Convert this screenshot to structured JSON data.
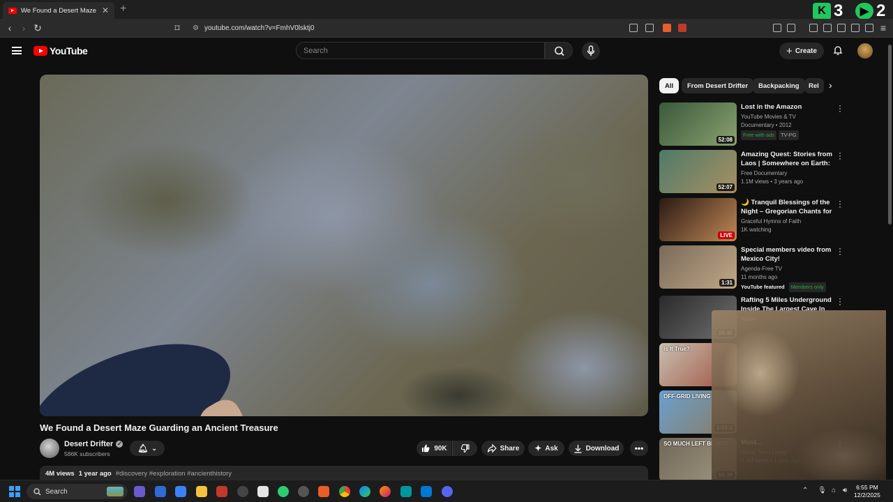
{
  "browser": {
    "tab_title": "We Found a Desert Maze Gu",
    "tab_close": "✕",
    "new_tab": "+",
    "url": "youtube.com/watch?v=FmhV0lsktj0",
    "ext_counts": [
      "3",
      "2"
    ]
  },
  "header": {
    "logo_text": "YouTube",
    "search_placeholder": "Search",
    "create_label": "Create"
  },
  "video": {
    "title": "We Found a Desert Maze Guarding an Ancient Treasure",
    "channel": "Desert Drifter",
    "subscribers": "586K subscribers",
    "likes": "90K",
    "share_label": "Share",
    "ask_label": "Ask",
    "download_label": "Download",
    "views": "4M views",
    "age": "1 year ago",
    "tags": "#discovery #exploration #ancienthistory"
  },
  "chips": [
    "All",
    "From Desert Drifter",
    "Backpacking",
    "Rel"
  ],
  "recommendations": [
    {
      "title": "Lost in the Amazon",
      "channel": "YouTube Movies & TV",
      "meta": "Documentary • 2012",
      "badges": [
        "Free with ads",
        "TV-PG"
      ],
      "duration": "52:08",
      "thumb_colors": [
        "#3a5a3a",
        "#8aa070"
      ]
    },
    {
      "title": "Amazing Quest: Stories from Laos | Somewhere on Earth: ...",
      "channel": "Free Documentary",
      "meta": "1.1M views • 3 years ago",
      "badges": [],
      "duration": "52:07",
      "thumb_colors": [
        "#4e7a6a",
        "#a89060"
      ]
    },
    {
      "title": "🌙 Tranquil Blessings of the Night – Gregorian Chants for ...",
      "channel": "Graceful Hymns of Faith",
      "meta": "1K watching",
      "badges": [],
      "duration": "LIVE",
      "thumb_colors": [
        "#2a1a12",
        "#c08858"
      ]
    },
    {
      "title": "Special members video from Mexico City!",
      "channel": "Agenda-Free TV",
      "meta": "11 months ago",
      "badges": [
        "YouTube featured",
        "Members only"
      ],
      "duration": "1:31",
      "thumb_colors": [
        "#7a6a58",
        "#c0a888"
      ]
    },
    {
      "title": "Rafting 5 Miles Underground Inside The Largest Cave In Th...",
      "channel": "Active",
      "meta": "",
      "badges": [],
      "duration": "34:40",
      "thumb_colors": [
        "#2a2a2a",
        "#707070"
      ]
    },
    {
      "title": "",
      "channel": "",
      "meta": "",
      "badges": [],
      "duration": "",
      "thumb_colors": [
        "#c8c0b0",
        "#a05040"
      ],
      "overlay": "Is It True?"
    },
    {
      "title": "",
      "channel": "",
      "meta": "",
      "badges": [],
      "duration": "1:03:2",
      "thumb_colors": [
        "#6aa0d0",
        "#8a7a60"
      ],
      "overlay": "OFF-GRID LIVING"
    },
    {
      "title": "Most...",
      "channel": "Ghost Town Living",
      "meta": "2.3M views • 1 year ago",
      "badges": [],
      "duration": "55:39",
      "thumb_colors": [
        "#706858",
        "#a09880"
      ],
      "overlay": "SO MUCH LEFT BEHIND..."
    }
  ],
  "taskbar": {
    "search_label": "Search",
    "time": "6:55 PM",
    "date": "12/2/2025"
  }
}
